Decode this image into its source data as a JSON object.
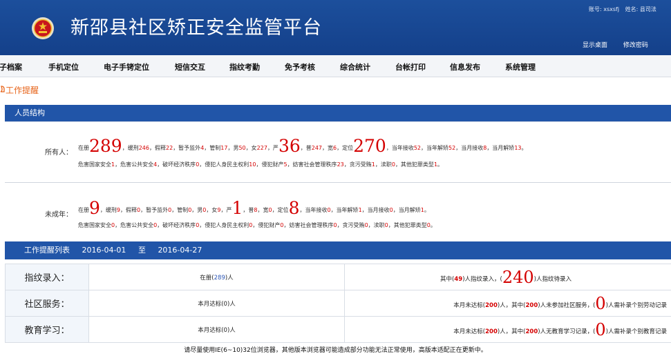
{
  "header": {
    "title": "新邵县社区矫正安全监管平台",
    "account_label": "账号: xsxsfj",
    "name_label": "姓名: 县司法",
    "links": [
      "显示桌面",
      "修改密码"
    ]
  },
  "nav": [
    "子档案",
    "手机定位",
    "电子手铐定位",
    "短信交互",
    "指纹考勤",
    "免予考核",
    "综合统计",
    "台帐打印",
    "信息发布",
    "系统管理"
  ],
  "reminder": {
    "title": "工作提醒"
  },
  "personnel": {
    "heading": "人员结构",
    "all": {
      "label": "所有人：",
      "p1": "在册",
      "v_reg": "289",
      "p2": "，缓刑",
      "v_huan": "246",
      "p3": "，假释",
      "v_jia": "22",
      "p4": "，暂予监外",
      "v_zan": "4",
      "p5": "，管制",
      "v_guan": "17",
      "p6": "，男",
      "v_male": "50",
      "p7": "，女",
      "v_female": "227",
      "p8": "，严",
      "v_yan": "36",
      "p9": "，普",
      "v_pu": "247",
      "p10": "，宽",
      "v_kuan": "6",
      "p11": "，定位",
      "v_loc": "270",
      "p12": "，当年接收",
      "v_ynr": "52",
      "p13": "，当年解矫",
      "v_ynj": "52",
      "p14": "，当月接收",
      "v_mnr": "8",
      "p15": "，当月解矫",
      "v_mnj": "13",
      "p16": "。",
      "q1": "危害国家安全",
      "c1": "1",
      "q2": "，危害公共安全",
      "c2": "4",
      "q3": "，破坏经济秩序",
      "c3": "0",
      "q4": "，侵犯人身民主权利",
      "c4": "10",
      "q5": "，侵犯财产",
      "c5": "5",
      "q6": "，妨害社会管理秩序",
      "c6": "23",
      "q7": "，贪污受贿",
      "c7": "1",
      "q8": "，渎职",
      "c8": "0",
      "q9": "，其他犯罪类型",
      "c9": "1",
      "q10": "。"
    },
    "minor": {
      "label": "未成年：",
      "p1": "在册",
      "v_reg": "9",
      "p2": "，缓刑",
      "v_huan": "9",
      "p3": "，假释",
      "v_jia": "0",
      "p4": "，暂予监外",
      "v_zan": "0",
      "p5": "，管制",
      "v_guan": "0",
      "p6": "，男",
      "v_male": "0",
      "p7": "，女",
      "v_female": "9",
      "p8": "，严",
      "v_yan": "1",
      "p9": "，普",
      "v_pu": "8",
      "p10": "，宽",
      "v_kuan": "0",
      "p11": "，定位",
      "v_loc": "8",
      "p12": "，当年接收",
      "v_ynr": "0",
      "p13": "，当年解矫",
      "v_ynj": "1",
      "p14": "，当月接收",
      "v_mnr": "0",
      "p15": "，当月解矫",
      "v_mnj": "1",
      "p16": "。",
      "q1": "危害国家安全",
      "c1": "0",
      "q2": "，危害公共安全",
      "c2": "0",
      "q3": "，破坏经济秩序",
      "c3": "0",
      "q4": "，侵犯人身民主权利",
      "c4": "0",
      "q5": "，侵犯财产",
      "c5": "0",
      "q6": "，妨害社会管理秩序",
      "c6": "0",
      "q7": "，贪污受贿",
      "c7": "0",
      "q8": "，渎职",
      "c8": "0",
      "q9": "，其他犯罪类型",
      "c9": "0",
      "q10": "。"
    }
  },
  "worklist": {
    "heading": "工作提醒列表",
    "date_from": "2016-04-01",
    "sep": "至",
    "date_to": "2016-04-27",
    "rows": [
      {
        "label": "指纹录入：",
        "mid_pre": "在册(",
        "mid_val": "289",
        "mid_post": ")人",
        "r_pre": "其中(",
        "r_v1": "49",
        "r_mid": ")人指纹录入，(",
        "r_big": "240",
        "r_post": ")人指纹待录入"
      },
      {
        "label": "社区服务：",
        "mid_pre": "本月达标(",
        "mid_val": "0",
        "mid_post": ")人",
        "r_pre": "本月未达标(",
        "r_v1": "200",
        "r_mid": ")人，其中(",
        "r_v2": "200",
        "r_mid2": ")人未参加社区服务，(",
        "r_big": "0",
        "r_post": ")人需补录个别劳动记录"
      },
      {
        "label": "教育学习：",
        "mid_pre": "本月达标(",
        "mid_val": "0",
        "mid_post": ")人",
        "r_pre": "本月未达标(",
        "r_v1": "200",
        "r_mid": ")人，其中(",
        "r_v2": "200",
        "r_mid2": ")人无教育学习记录，(",
        "r_big": "0",
        "r_post": ")人需补录个别教育记录"
      }
    ]
  },
  "footer": {
    "notice": "请尽量使用IE(6~10)32位浏览器，其他版本浏览器可能造成部分功能无法正常使用，高版本适配正在更新中。"
  }
}
